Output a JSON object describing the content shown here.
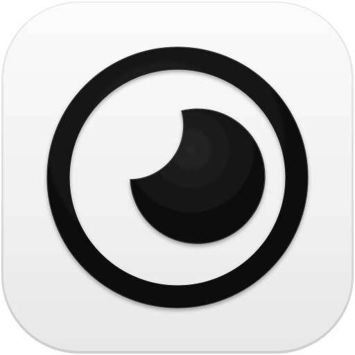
{
  "app_icon": {
    "icon": "eye-icon",
    "colors": {
      "tile_top": "#fbfbfb",
      "tile_bottom": "#e9e9e9",
      "tile_edge": "#d4d4d4",
      "glyph": "#0a0a0a",
      "glyph_highlight": "#4a4a4a"
    }
  }
}
